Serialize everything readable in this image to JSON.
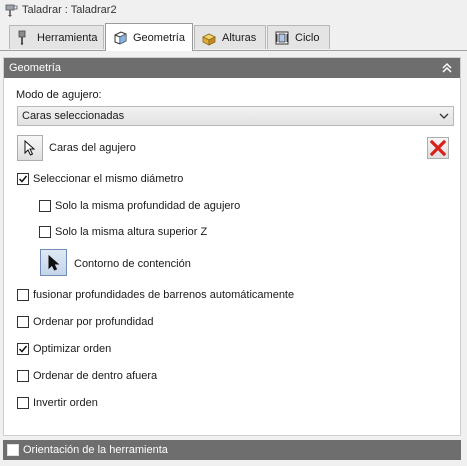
{
  "window": {
    "title": "Taladrar : Taladrar2"
  },
  "tabs": [
    {
      "label": "Herramienta",
      "icon": "drill-tool-icon",
      "active": false
    },
    {
      "label": "Geometría",
      "icon": "cube-icon",
      "active": true
    },
    {
      "label": "Alturas",
      "icon": "heights-icon",
      "active": false
    },
    {
      "label": "Ciclo",
      "icon": "cycle-icon",
      "active": false
    }
  ],
  "geometry": {
    "header": "Geometría",
    "hole_mode_label": "Modo de agujero:",
    "hole_mode_value": "Caras seleccionadas",
    "hole_faces_label": "Caras del agujero",
    "same_diameter": {
      "label": "Seleccionar el mismo diámetro",
      "checked": true
    },
    "same_depth": {
      "label": "Solo la misma profundidad de agujero",
      "checked": false
    },
    "same_top_z": {
      "label": "Solo la misma altura superior Z",
      "checked": false
    },
    "containment_label": "Contorno de contención",
    "merge_depths": {
      "label": "fusionar profundidades de barrenos automáticamente",
      "checked": false
    },
    "order_by_depth": {
      "label": "Ordenar por profundidad",
      "checked": false
    },
    "optimize_order": {
      "label": "Optimizar orden",
      "checked": true
    },
    "inside_out": {
      "label": "Ordenar de dentro afuera",
      "checked": false
    },
    "reverse_order": {
      "label": "Invertir orden",
      "checked": false
    }
  },
  "tool_orientation": {
    "label": "Orientación de la herramienta",
    "checked": false
  },
  "colors": {
    "section_header_bg": "#6e6e6e",
    "clear_icon_red": "#d9201a"
  }
}
